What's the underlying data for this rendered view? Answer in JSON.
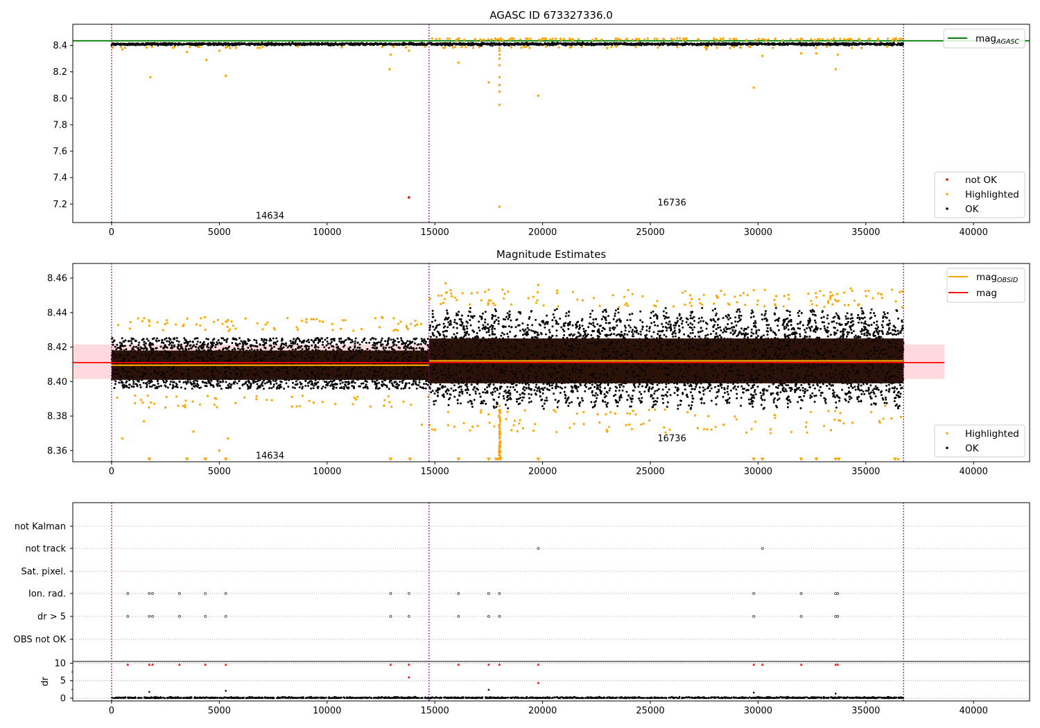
{
  "chart_data": [
    {
      "type": "scatter",
      "title": "AGASC ID 673327336.0",
      "xlim": [
        -1800,
        42600
      ],
      "ylim": [
        7.06,
        8.56
      ],
      "x_ticks": [
        0,
        5000,
        10000,
        15000,
        20000,
        25000,
        30000,
        35000,
        40000
      ],
      "y_ticks": [
        7.2,
        7.4,
        7.6,
        7.8,
        8.0,
        8.2,
        8.4
      ],
      "obs_boundaries": [
        0,
        14730,
        36750
      ],
      "obsid_labels": [
        {
          "text": "14634",
          "x": 7350,
          "y": 7.11
        },
        {
          "text": "16736",
          "x": 26000,
          "y": 7.21
        }
      ],
      "lines": [
        {
          "name": "mag_AGASC",
          "value": 8.435,
          "color": "#008000"
        }
      ],
      "ok_band": {
        "x_range": [
          0,
          36750
        ],
        "y_center": 8.41,
        "spread": 0.008
      },
      "highlighted_points": [
        [
          500,
          8.37
        ],
        [
          1800,
          8.16
        ],
        [
          3500,
          8.35
        ],
        [
          4400,
          8.29
        ],
        [
          5000,
          8.36
        ],
        [
          5300,
          8.17
        ],
        [
          5500,
          8.38
        ],
        [
          12900,
          8.22
        ],
        [
          12950,
          8.33
        ],
        [
          13800,
          8.36
        ],
        [
          16100,
          8.27
        ],
        [
          17500,
          8.12
        ],
        [
          18000,
          7.95
        ],
        [
          18000,
          8.05
        ],
        [
          18000,
          8.1
        ],
        [
          18000,
          8.16
        ],
        [
          18000,
          8.25
        ],
        [
          18000,
          8.3
        ],
        [
          18000,
          8.33
        ],
        [
          18000,
          8.36
        ],
        [
          18000,
          8.38
        ],
        [
          18000,
          7.18
        ],
        [
          19800,
          8.02
        ],
        [
          23000,
          8.38
        ],
        [
          27600,
          8.37
        ],
        [
          28700,
          8.38
        ],
        [
          29800,
          8.08
        ],
        [
          30200,
          8.32
        ],
        [
          32000,
          8.34
        ],
        [
          32700,
          8.34
        ],
        [
          33600,
          8.22
        ],
        [
          33700,
          8.33
        ],
        [
          34800,
          8.38
        ]
      ],
      "not_ok_points": [
        [
          13800,
          7.25
        ]
      ],
      "legends": [
        {
          "position": "top-right",
          "entries": [
            {
              "label": "mag",
              "subscript": "AGASC",
              "kind": "line",
              "color": "#008000"
            }
          ]
        },
        {
          "position": "bottom-right",
          "entries": [
            {
              "label": "not OK",
              "kind": "dot",
              "color": "#ff0000"
            },
            {
              "label": "Highlighted",
              "kind": "dot",
              "color": "#ffa500"
            },
            {
              "label": "OK",
              "kind": "dot",
              "color": "#000000"
            }
          ]
        }
      ]
    },
    {
      "type": "scatter",
      "title": "Magnitude Estimates",
      "xlim": [
        -1800,
        42600
      ],
      "ylim": [
        8.3535,
        8.4685
      ],
      "x_ticks": [
        0,
        5000,
        10000,
        15000,
        20000,
        25000,
        30000,
        35000,
        40000
      ],
      "y_ticks": [
        8.36,
        8.38,
        8.4,
        8.42,
        8.44,
        8.46
      ],
      "obs_boundaries": [
        0,
        14730,
        36750
      ],
      "obsid_labels": [
        {
          "text": "14634",
          "x": 7350,
          "y": 8.357
        },
        {
          "text": "16736",
          "x": 26000,
          "y": 8.367
        }
      ],
      "lines": [
        {
          "name": "mag",
          "value": 8.411,
          "x_range": [
            -1800,
            38650
          ],
          "color": "#ff0000"
        },
        {
          "name": "mag_OBSID 14634",
          "value": 8.4095,
          "x_range": [
            0,
            14730
          ],
          "color": "#ffa500"
        },
        {
          "name": "mag_OBSID 16736",
          "value": 8.412,
          "x_range": [
            14730,
            36750
          ],
          "color": "#ffa500"
        }
      ],
      "band": {
        "x_range": [
          -1800,
          38650
        ],
        "y_range": [
          8.4015,
          8.4215
        ],
        "color": "#ffd9dc"
      },
      "obs_scatter": [
        {
          "x_range": [
            0,
            14730
          ],
          "core": [
            8.401,
            8.418
          ],
          "outer": [
            8.392,
            8.429
          ],
          "highlight_range": [
            8.385,
            8.44
          ]
        },
        {
          "x_range": [
            14730,
            36750
          ],
          "core": [
            8.399,
            8.425
          ],
          "outer": [
            8.384,
            8.443
          ],
          "highlight_range": [
            8.37,
            8.456
          ]
        }
      ],
      "highlighted_points": [
        [
          500,
          8.367
        ],
        [
          1500,
          8.377
        ],
        [
          2500,
          8.385
        ],
        [
          3800,
          8.371
        ],
        [
          5000,
          8.36
        ],
        [
          5400,
          8.367
        ],
        [
          14400,
          8.375
        ],
        [
          15500,
          8.457
        ],
        [
          17500,
          8.381
        ],
        [
          18000,
          8.359
        ],
        [
          18000,
          8.363
        ],
        [
          18000,
          8.367
        ],
        [
          18000,
          8.371
        ],
        [
          18000,
          8.375
        ],
        [
          18000,
          8.379
        ],
        [
          18000,
          8.383
        ],
        [
          19800,
          8.456
        ],
        [
          23000,
          8.371
        ],
        [
          24200,
          8.383
        ],
        [
          27200,
          8.373
        ],
        [
          27700,
          8.38
        ],
        [
          28400,
          8.375
        ],
        [
          29800,
          8.453
        ],
        [
          34300,
          8.454
        ],
        [
          35900,
          8.386
        ],
        [
          36500,
          8.355
        ]
      ],
      "clipped_points_x": [
        1750,
        3500,
        4350,
        5300,
        12950,
        13850,
        16100,
        17500,
        17850,
        17950,
        18050,
        19800,
        29800,
        30200,
        32000,
        32700,
        33600,
        33750,
        36350
      ],
      "legends": [
        {
          "position": "top-right",
          "entries": [
            {
              "label": "mag",
              "subscript": "OBSID",
              "kind": "line",
              "color": "#ffa500"
            },
            {
              "label": "mag",
              "kind": "line",
              "color": "#ff0000"
            }
          ]
        },
        {
          "position": "bottom-right",
          "entries": [
            {
              "label": "Highlighted",
              "kind": "dot",
              "color": "#ffa500"
            },
            {
              "label": "OK",
              "kind": "dot",
              "color": "#000000"
            }
          ]
        }
      ]
    },
    {
      "type": "scatter",
      "title": "",
      "xlim": [
        -1800,
        42600
      ],
      "x_ticks": [
        0,
        5000,
        10000,
        15000,
        20000,
        25000,
        30000,
        35000,
        40000
      ],
      "obs_boundaries": [
        0,
        14730,
        36750
      ],
      "flag_rows": [
        "not Kalman",
        "not track",
        "Sat. pixel.",
        "Ion. rad.",
        "dr > 5",
        "OBS not OK"
      ],
      "flag_points": {
        "not track": [
          19800,
          30200
        ],
        "Ion. rad.": [
          750,
          1750,
          1900,
          3150,
          4350,
          5300,
          12950,
          13800,
          16100,
          17500,
          18000,
          29800,
          32000,
          33600,
          33700
        ],
        "dr > 5": [
          750,
          1750,
          1900,
          3150,
          4350,
          5300,
          12950,
          13800,
          16100,
          17500,
          18000,
          29800,
          32000,
          33600,
          33700
        ]
      },
      "dr_ylim": [
        -0.8,
        10.5
      ],
      "dr_y_ticks": [
        0,
        5,
        10
      ],
      "dr_ylabel": "dr",
      "dr_red_points": [
        [
          750,
          9.6
        ],
        [
          1750,
          9.6
        ],
        [
          1900,
          9.6
        ],
        [
          3150,
          9.6
        ],
        [
          4350,
          9.6
        ],
        [
          5300,
          9.6
        ],
        [
          12950,
          9.6
        ],
        [
          13800,
          9.6
        ],
        [
          13800,
          6.0
        ],
        [
          16100,
          9.6
        ],
        [
          17500,
          9.6
        ],
        [
          18000,
          9.6
        ],
        [
          19800,
          9.6
        ],
        [
          19800,
          4.4
        ],
        [
          29800,
          9.6
        ],
        [
          30200,
          9.6
        ],
        [
          32000,
          9.6
        ],
        [
          33600,
          9.6
        ],
        [
          33700,
          9.6
        ]
      ],
      "dr_black_points": [
        [
          1750,
          1.8
        ],
        [
          5300,
          2.1
        ],
        [
          17500,
          2.4
        ],
        [
          29800,
          1.6
        ],
        [
          33600,
          1.3
        ]
      ]
    }
  ]
}
